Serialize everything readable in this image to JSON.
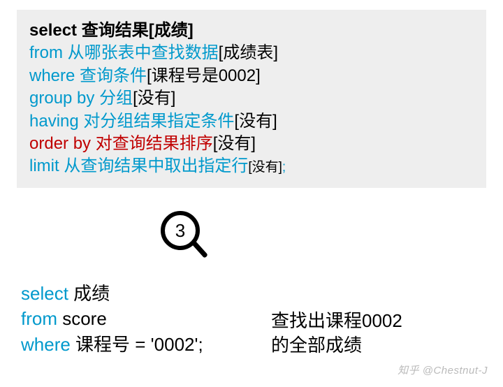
{
  "template": {
    "l1_kw": "select",
    "l1_zh": " 查询结果",
    "l1_br": "[成绩]",
    "l2_kw": "from",
    "l2_zh": " 从哪张表中查找数据",
    "l2_br": "[成绩表]",
    "l3_kw": "where",
    "l3_zh": " 查询条件",
    "l3_br": "[课程号是0002]",
    "l4_kw": "group by",
    "l4_zh": " 分组",
    "l4_br": "[没有]",
    "l5_kw": "having",
    "l5_zh": " 对分组结果指定条件",
    "l5_br": "[没有]",
    "l6_kw": "order by",
    "l6_zh": " 对查询结果排序",
    "l6_br": "[没有]",
    "l7_kw": "limit",
    "l7_zh": " 从查询结果中取出指定行",
    "l7_br": "[没有]",
    "semi": ";"
  },
  "step_number": "3",
  "query": {
    "l1_kw": "select",
    "l1_txt": " 成绩",
    "l2_kw": "from",
    "l2_txt": " score",
    "l3_kw": "where",
    "l3_txt": " 课程号 = '0002';"
  },
  "desc": {
    "line1": "查找出课程0002",
    "line2": "的全部成绩"
  },
  "watermark": "知乎 @Chestnut-J"
}
